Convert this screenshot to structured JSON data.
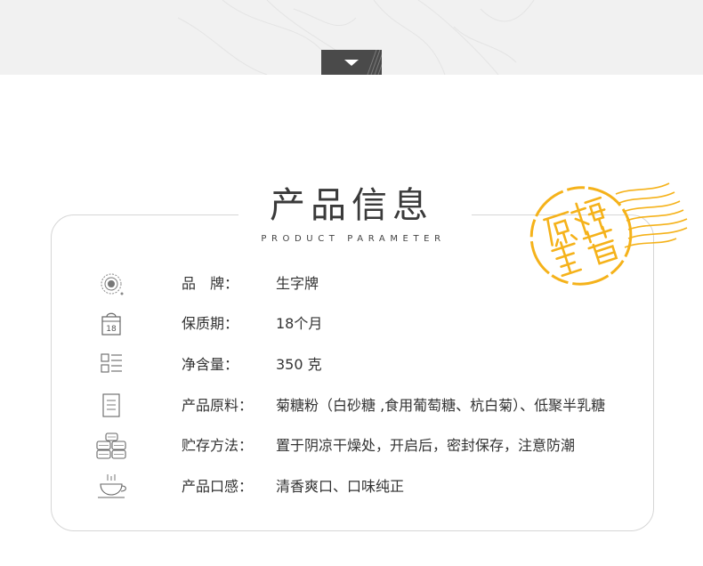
{
  "section": {
    "title": "产品信息",
    "subtitle": "PRODUCT PARAMETER"
  },
  "stamp": {
    "text": "原糖象藿",
    "color": "#f5b21a"
  },
  "toggle": {
    "icon": "chevron-down-icon"
  },
  "params": [
    {
      "icon": "brand-seal-icon",
      "label": "品　牌：",
      "value": "生字牌"
    },
    {
      "icon": "calendar-icon",
      "label": "保质期：",
      "value": "18个月"
    },
    {
      "icon": "grid-list-icon",
      "label": "净含量：",
      "value": "350 克"
    },
    {
      "icon": "document-icon",
      "label": "产品原料：",
      "value": "菊糖粉（白砂糖 ,食用葡萄糖、杭白菊）、低聚半乳糖"
    },
    {
      "icon": "storage-stack-icon",
      "label": "贮存方法：",
      "value": "置于阴凉干燥处，开启后，密封保存，注意防潮"
    },
    {
      "icon": "tea-cup-icon",
      "label": "产品口感：",
      "value": "清香爽口、口味纯正"
    }
  ],
  "calendar_number": "18",
  "colors": {
    "accent": "#f5b21a",
    "tab": "#4a4a4a",
    "band": "#f1f1f1"
  }
}
